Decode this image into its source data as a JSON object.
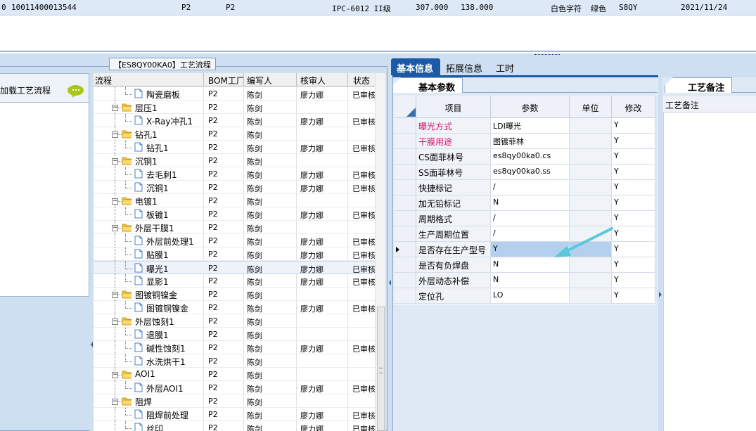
{
  "topbar": {
    "f1": "0",
    "f2": "10011400013544",
    "f3": "P2",
    "f4": "P2",
    "f5": "IPC-6012 II级",
    "f6": "307.000",
    "f7": "138.000",
    "f8": "白色字符",
    "f9": "绿色",
    "f10": "S8QY",
    "f11": "2021/11/24"
  },
  "left": {
    "title": "【ES8QY00KA0】工艺流程",
    "load_label": "加载工艺流程",
    "columns": [
      "流程",
      "BOM工厂",
      "编写人",
      "核审人",
      "状态"
    ]
  },
  "tree_rows": [
    {
      "name": "陶瓷磨板",
      "level": 2,
      "icon": "doc",
      "factory": "P2",
      "writer": "陈剑",
      "reviewer": "廖力娜",
      "status": "已审核"
    },
    {
      "name": "层压1",
      "level": 1,
      "icon": "folder",
      "factory": "P2",
      "writer": "陈剑",
      "reviewer": "",
      "status": ""
    },
    {
      "name": "X-Ray冲孔1",
      "level": 2,
      "icon": "doc",
      "factory": "P2",
      "writer": "陈剑",
      "reviewer": "廖力娜",
      "status": "已审核"
    },
    {
      "name": "钻孔1",
      "level": 1,
      "icon": "folder",
      "factory": "P2",
      "writer": "陈剑",
      "reviewer": "",
      "status": ""
    },
    {
      "name": "钻孔1",
      "level": 2,
      "icon": "doc",
      "factory": "P2",
      "writer": "陈剑",
      "reviewer": "廖力娜",
      "status": "已审核"
    },
    {
      "name": "沉铜1",
      "level": 1,
      "icon": "folder",
      "factory": "P2",
      "writer": "陈剑",
      "reviewer": "",
      "status": ""
    },
    {
      "name": "去毛刺1",
      "level": 2,
      "icon": "doc",
      "factory": "P2",
      "writer": "陈剑",
      "reviewer": "廖力娜",
      "status": "已审核"
    },
    {
      "name": "沉铜1",
      "level": 2,
      "icon": "doc",
      "factory": "P2",
      "writer": "陈剑",
      "reviewer": "廖力娜",
      "status": "已审核"
    },
    {
      "name": "电镀1",
      "level": 1,
      "icon": "folder",
      "factory": "P2",
      "writer": "陈剑",
      "reviewer": "",
      "status": ""
    },
    {
      "name": "板镀1",
      "level": 2,
      "icon": "doc",
      "factory": "P2",
      "writer": "陈剑",
      "reviewer": "廖力娜",
      "status": "已审核"
    },
    {
      "name": "外层干膜1",
      "level": 1,
      "icon": "folder",
      "factory": "P2",
      "writer": "陈剑",
      "reviewer": "",
      "status": ""
    },
    {
      "name": "外层前处理1",
      "level": 2,
      "icon": "doc",
      "factory": "P2",
      "writer": "陈剑",
      "reviewer": "廖力娜",
      "status": "已审核"
    },
    {
      "name": "贴膜1",
      "level": 2,
      "icon": "doc",
      "factory": "P2",
      "writer": "陈剑",
      "reviewer": "廖力娜",
      "status": "已审核"
    },
    {
      "name": "曝光1",
      "level": 2,
      "icon": "doc",
      "factory": "P2",
      "writer": "陈剑",
      "reviewer": "廖力娜",
      "status": "已审核",
      "selected": true
    },
    {
      "name": "显影1",
      "level": 2,
      "icon": "doc",
      "factory": "P2",
      "writer": "陈剑",
      "reviewer": "廖力娜",
      "status": "已审核"
    },
    {
      "name": "图镀铜镍金",
      "level": 1,
      "icon": "folder",
      "factory": "P2",
      "writer": "陈剑",
      "reviewer": "",
      "status": ""
    },
    {
      "name": "图镀铜镍金",
      "level": 2,
      "icon": "doc",
      "factory": "P2",
      "writer": "陈剑",
      "reviewer": "廖力娜",
      "status": "已审核"
    },
    {
      "name": "外层蚀刻1",
      "level": 1,
      "icon": "folder",
      "factory": "P2",
      "writer": "陈剑",
      "reviewer": "",
      "status": ""
    },
    {
      "name": "退膜1",
      "level": 2,
      "icon": "doc",
      "factory": "P2",
      "writer": "陈剑",
      "reviewer": "",
      "status": ""
    },
    {
      "name": "碱性蚀刻1",
      "level": 2,
      "icon": "doc",
      "factory": "P2",
      "writer": "陈剑",
      "reviewer": "廖力娜",
      "status": "已审核"
    },
    {
      "name": "水洗烘干1",
      "level": 2,
      "icon": "doc",
      "factory": "P2",
      "writer": "陈剑",
      "reviewer": "",
      "status": ""
    },
    {
      "name": "AOI1",
      "level": 1,
      "icon": "folder",
      "factory": "P2",
      "writer": "陈剑",
      "reviewer": "",
      "status": ""
    },
    {
      "name": "外层AOI1",
      "level": 2,
      "icon": "doc",
      "factory": "P2",
      "writer": "陈剑",
      "reviewer": "廖力娜",
      "status": "已审核"
    },
    {
      "name": "阻焊",
      "level": 1,
      "icon": "folder",
      "factory": "P2",
      "writer": "陈剑",
      "reviewer": "",
      "status": ""
    },
    {
      "name": "阻焊前处理",
      "level": 2,
      "icon": "doc",
      "factory": "P2",
      "writer": "陈剑",
      "reviewer": "廖力娜",
      "status": "已审核"
    },
    {
      "name": "丝印",
      "level": 2,
      "icon": "doc",
      "factory": "P2",
      "writer": "陈剑",
      "reviewer": "廖力娜",
      "status": "已审核"
    }
  ],
  "right": {
    "tabs": [
      "基本信息",
      "拓展信息",
      "工时"
    ],
    "subtab": "基本参数",
    "note_tab": "工艺备注",
    "note_header": "工艺备注",
    "grid_columns": [
      "项目",
      "参数",
      "单位",
      "修改"
    ],
    "params": [
      {
        "item": "曝光方式",
        "value": "LDI曝光",
        "unit": "",
        "mod": "Y",
        "pink": true
      },
      {
        "item": "干膜用途",
        "value": "图镀菲林",
        "unit": "",
        "mod": "Y",
        "pink": true
      },
      {
        "item": "CS面菲林号",
        "value": "es8qy00ka0.cs",
        "unit": "",
        "mod": "Y"
      },
      {
        "item": "SS面菲林号",
        "value": "es8qy00ka0.ss",
        "unit": "",
        "mod": "Y"
      },
      {
        "item": "快捷标记",
        "value": "/",
        "unit": "",
        "mod": "Y"
      },
      {
        "item": "加无铅标记",
        "value": "N",
        "unit": "",
        "mod": "Y"
      },
      {
        "item": "周期格式",
        "value": "/",
        "unit": "",
        "mod": "Y"
      },
      {
        "item": "生产周期位置",
        "value": "/",
        "unit": "",
        "mod": "Y"
      },
      {
        "item": "是否存在生产型号",
        "value": "Y",
        "unit": "",
        "mod": "Y",
        "selected": true
      },
      {
        "item": "是否有负焊盘",
        "value": "N",
        "unit": "",
        "mod": "Y"
      },
      {
        "item": "外层动态补偿",
        "value": "N",
        "unit": "",
        "mod": "Y"
      },
      {
        "item": "定位孔",
        "value": "LO",
        "unit": "",
        "mod": "Y"
      }
    ]
  },
  "colors": {
    "accent": "#1c5aa6",
    "pink": "#c8126e",
    "panel": "#cfdff2",
    "arrow": "#5bc8d8"
  }
}
